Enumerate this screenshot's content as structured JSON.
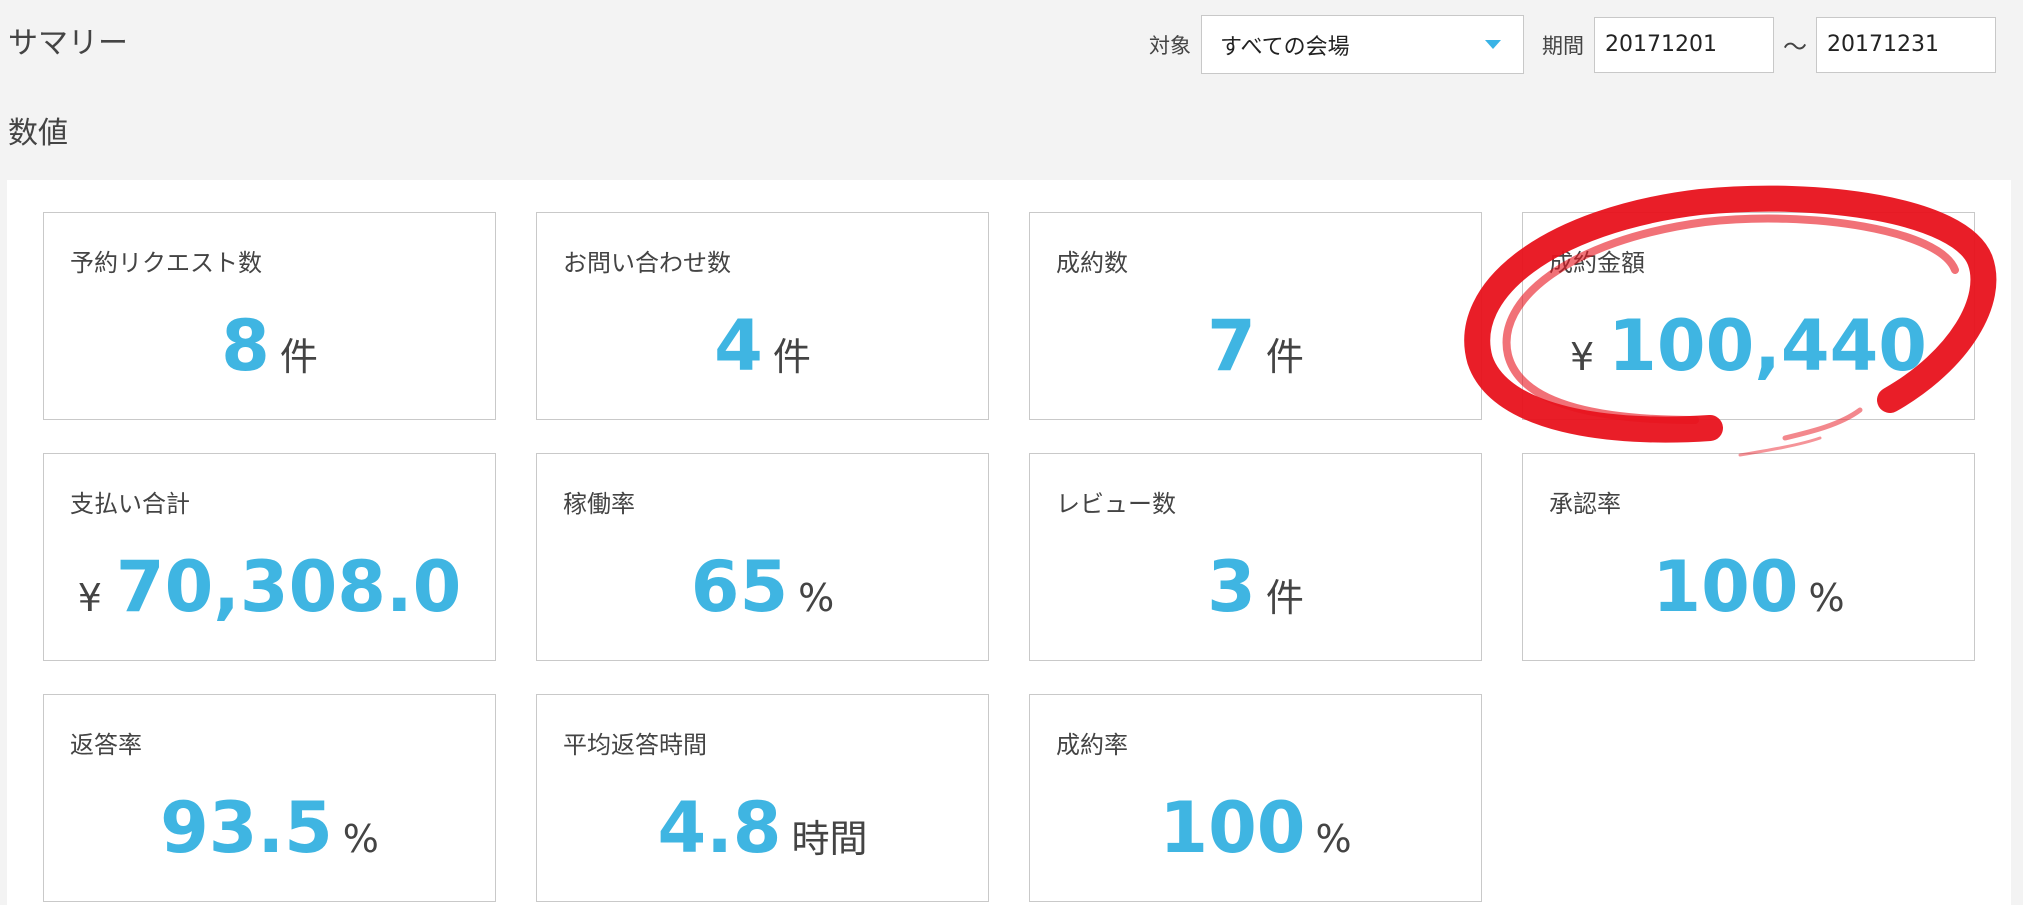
{
  "header": {
    "title": "サマリー",
    "target_label": "対象",
    "venue_select": {
      "selected": "すべての会場"
    },
    "period_label": "期間",
    "date_from": "20171201",
    "separator": "〜",
    "date_to": "20171231"
  },
  "section_title": "数値",
  "colors": {
    "accent": "#3fb5e2",
    "annotation": "#e8121c"
  },
  "cards": [
    {
      "label": "予約リクエスト数",
      "value": "8",
      "unit": "件"
    },
    {
      "label": "お問い合わせ数",
      "value": "4",
      "unit": "件"
    },
    {
      "label": "成約数",
      "value": "7",
      "unit": "件"
    },
    {
      "label": "成約金額",
      "prefix": "¥",
      "value": "100,440"
    },
    {
      "label": "支払い合計",
      "prefix": "¥",
      "value": "70,308.0"
    },
    {
      "label": "稼働率",
      "value": "65",
      "unit": "%"
    },
    {
      "label": "レビュー数",
      "value": "3",
      "unit": "件"
    },
    {
      "label": "承認率",
      "value": "100",
      "unit": "%"
    },
    {
      "label": "返答率",
      "value": "93.5",
      "unit": "%"
    },
    {
      "label": "平均返答時間",
      "value": "4.8",
      "unit": "時間"
    },
    {
      "label": "成約率",
      "value": "100",
      "unit": "%"
    }
  ]
}
